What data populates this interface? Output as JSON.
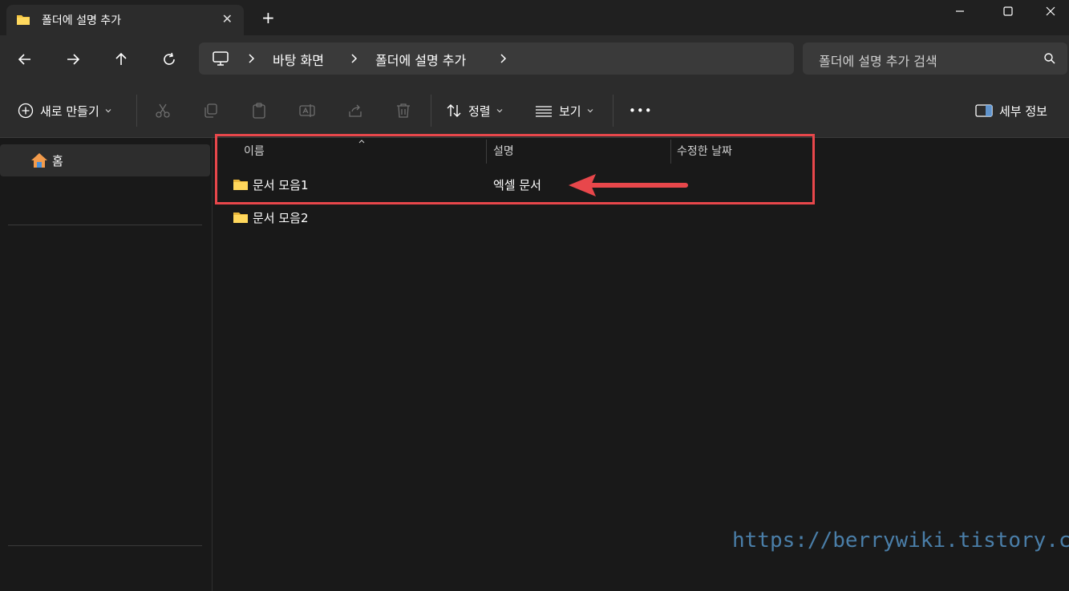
{
  "window": {
    "tab_title": "폴더에 설명 추가",
    "new_tab": "+",
    "close_tab": "✕"
  },
  "breadcrumb": {
    "items": [
      "바탕 화면",
      "폴더에 설명 추가"
    ]
  },
  "search": {
    "placeholder": "폴더에 설명 추가 검색"
  },
  "toolbar": {
    "new_label": "새로 만들기",
    "sort_label": "정렬",
    "view_label": "보기",
    "more_label": "•••",
    "details_label": "세부 정보"
  },
  "sidebar": {
    "home_label": "홈"
  },
  "columns": {
    "name": "이름",
    "description": "설명",
    "modified": "수정한 날짜"
  },
  "files": [
    {
      "name": "문서 모음1",
      "description": "엑셀 문서"
    },
    {
      "name": "문서 모음2",
      "description": ""
    }
  ],
  "watermark": "https://berrywiki.tistory.com",
  "colors": {
    "accent_red": "#e8474b",
    "folder_yellow": "#f4c542",
    "watermark_blue": "#4a7ea8"
  }
}
